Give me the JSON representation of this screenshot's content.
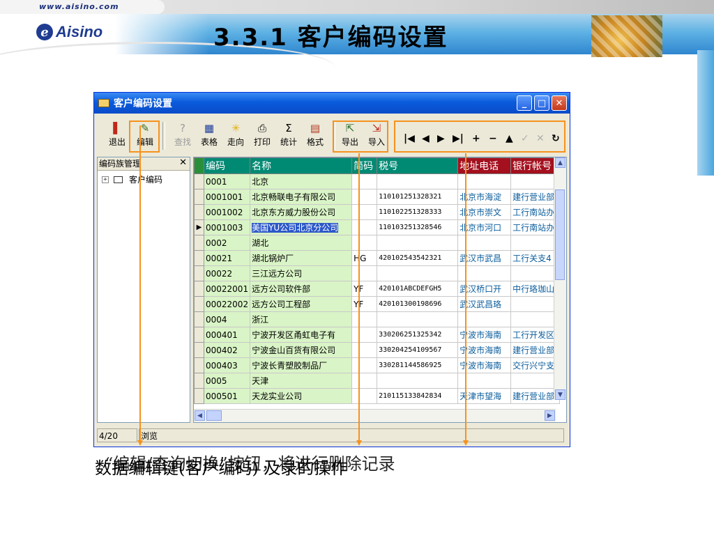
{
  "slide": {
    "url": "www.aisino.com",
    "logo_text": "Aisino",
    "title": "3.3.1 客户编码设置",
    "caption_line1": "数据编辑键(客户编码) 及录的操作",
    "caption_line2": "“编辑/查询切换”按钮，将进行删除记录"
  },
  "window": {
    "title": "客户编码设置",
    "min": "_",
    "max": "□",
    "close": "✕"
  },
  "toolbar": {
    "exit": "退出",
    "edit": "编辑",
    "find": "查找",
    "table": "表格",
    "direction": "走向",
    "print": "打印",
    "stats": "统计",
    "format": "格式",
    "export": "导出",
    "import": "导入",
    "nav": [
      "|◀",
      "◀",
      "▶",
      "▶|",
      "+",
      "−",
      "▲",
      "✓",
      "✕",
      "↻"
    ]
  },
  "tree": {
    "header": "编码族管理",
    "close": "✕",
    "root": "客户编码"
  },
  "grid": {
    "columns": [
      "编码",
      "名称",
      "简码",
      "税号",
      "地址电话",
      "银行帐号"
    ],
    "rows": [
      {
        "code": "0001",
        "name": "北京",
        "short": "",
        "tax": "",
        "addr": "",
        "bank": ""
      },
      {
        "code": "0001001",
        "name": "北京畅联电子有限公司",
        "short": "",
        "tax": "110101251328321",
        "addr": "北京市海淀",
        "bank": "建行营业部"
      },
      {
        "code": "0001002",
        "name": "北京东方威力股份公司",
        "short": "",
        "tax": "110102251328333",
        "addr": "北京市崇文",
        "bank": "工行南站办"
      },
      {
        "code": "0001003",
        "name": "美国YU公司北京分公司",
        "short": "",
        "tax": "110103251328546",
        "addr": "北京市河口",
        "bank": "工行南站办"
      },
      {
        "code": "0002",
        "name": "湖北",
        "short": "",
        "tax": "",
        "addr": "",
        "bank": ""
      },
      {
        "code": "00021",
        "name": "湖北锅炉厂",
        "short": "HG",
        "tax": "420102543542321",
        "addr": "武汉市武昌",
        "bank": "工行关支4"
      },
      {
        "code": "00022",
        "name": "三江远方公司",
        "short": "",
        "tax": "",
        "addr": "",
        "bank": ""
      },
      {
        "code": "00022001",
        "name": "远方公司软件部",
        "short": "YF",
        "tax": "420101ABCDEFGH5",
        "addr": "武汉桥口开",
        "bank": "中行珞珈山"
      },
      {
        "code": "00022002",
        "name": "远方公司工程部",
        "short": "YF",
        "tax": "420101300198696",
        "addr": "武汉武昌珞",
        "bank": ""
      },
      {
        "code": "0004",
        "name": "浙江",
        "short": "",
        "tax": "",
        "addr": "",
        "bank": ""
      },
      {
        "code": "000401",
        "name": "宁波开发区甬虹电子有",
        "short": "",
        "tax": "330206251325342",
        "addr": "宁波市海南",
        "bank": "工行开发区"
      },
      {
        "code": "000402",
        "name": "宁波金山百货有限公司",
        "short": "",
        "tax": "330204254109567",
        "addr": "宁波市海南",
        "bank": "建行营业部"
      },
      {
        "code": "000403",
        "name": "宁波长青塑胶制品厂",
        "short": "",
        "tax": "330281144586925",
        "addr": "宁波市海南",
        "bank": "交行兴宁支"
      },
      {
        "code": "0005",
        "name": "天津",
        "short": "",
        "tax": "",
        "addr": "",
        "bank": ""
      },
      {
        "code": "000501",
        "name": "天龙实业公司",
        "short": "",
        "tax": "210115133842834",
        "addr": "天津市望海",
        "bank": "建行营业部"
      }
    ],
    "selected_row": 3
  },
  "status": {
    "record": "4/20",
    "mode": "浏览"
  }
}
